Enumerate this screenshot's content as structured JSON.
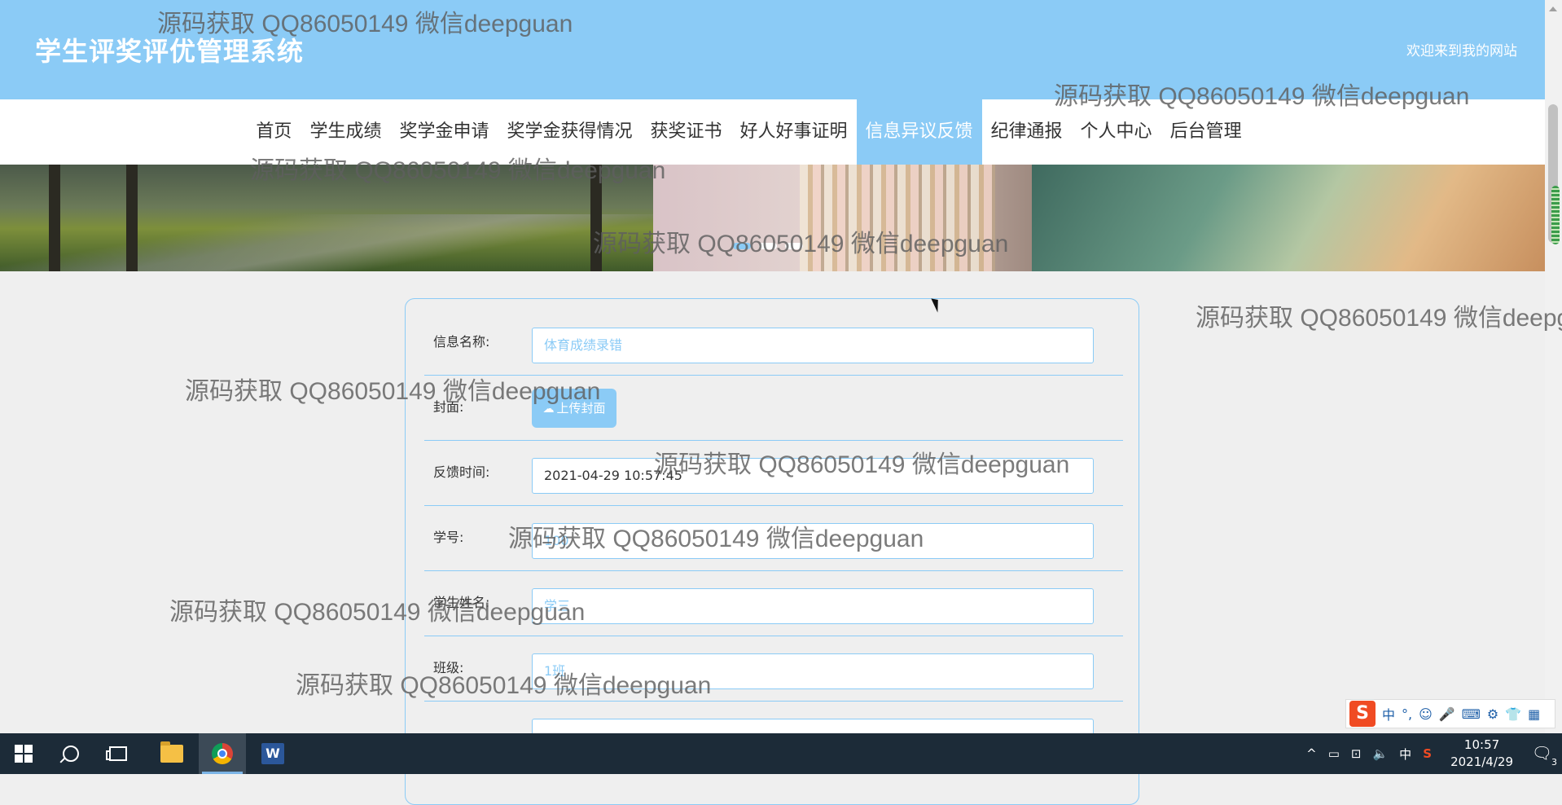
{
  "header": {
    "title": "学生评奖评优管理系统",
    "welcome": "欢迎来到我的网站"
  },
  "nav": {
    "items": [
      "首页",
      "学生成绩",
      "奖学金申请",
      "奖学金获得情况",
      "获奖证书",
      "好人好事证明",
      "信息异议反馈",
      "纪律通报",
      "个人中心",
      "后台管理"
    ],
    "active_index": 6
  },
  "banner": {
    "slide_count": 3,
    "active_slide": 1
  },
  "form": {
    "name_label": "信息名称:",
    "name_placeholder": "体育成绩录错",
    "cover_label": "封面:",
    "upload_label": "上传封面",
    "time_label": "反馈时间:",
    "time_value": "2021-04-29 10:57:45",
    "id_label": "学号:",
    "id_placeholder": "100",
    "student_name_label": "学生姓名:",
    "student_name_placeholder": "学三",
    "class_label": "班级:",
    "class_placeholder": "1班"
  },
  "watermark": {
    "text": "源码获取 QQ86050149 微信deepguan"
  },
  "ime": {
    "logo": "S",
    "lang": "中",
    "punct": "°,"
  },
  "taskbar": {
    "tray_ime": "中",
    "time": "10:57",
    "date": "2021/4/29",
    "notification_count": "3"
  },
  "colors": {
    "accent": "#8bcbf6",
    "taskbar": "#1c2b38"
  }
}
